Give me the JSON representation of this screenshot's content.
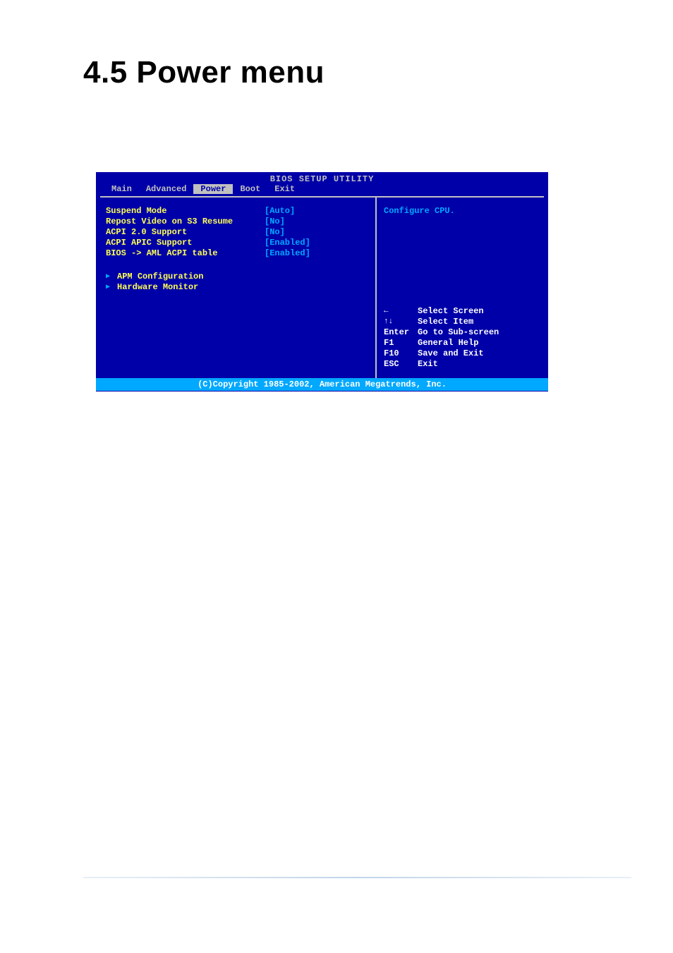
{
  "page_heading": "4.5    Power menu",
  "bios": {
    "title": "BIOS SETUP UTILITY",
    "tabs": [
      {
        "label": "Main"
      },
      {
        "label": "Advanced"
      },
      {
        "label": "Power"
      },
      {
        "label": "Boot"
      },
      {
        "label": "Exit"
      }
    ],
    "options": [
      {
        "label": "Suspend Mode",
        "value": "[Auto]"
      },
      {
        "label": "Repost Video on S3 Resume",
        "value": "[No]"
      },
      {
        "label": "ACPI 2.0 Support",
        "value": "[No]"
      },
      {
        "label": "ACPI APIC Support",
        "value": "[Enabled]"
      },
      {
        "label": "BIOS -> AML ACPI table",
        "value": "[Enabled]"
      }
    ],
    "submenus": [
      {
        "label": "APM Configuration"
      },
      {
        "label": "Hardware Monitor"
      }
    ],
    "help_text": "Configure CPU.",
    "nav": [
      {
        "key": "←",
        "desc": "Select Screen"
      },
      {
        "key": "↑↓",
        "desc": "Select Item"
      },
      {
        "key": "Enter",
        "desc": "Go to Sub-screen"
      },
      {
        "key": "F1",
        "desc": "General Help"
      },
      {
        "key": "F10",
        "desc": "Save and Exit"
      },
      {
        "key": "ESC",
        "desc": "Exit"
      }
    ],
    "copyright": "(C)Copyright 1985-2002, American Megatrends, Inc."
  }
}
